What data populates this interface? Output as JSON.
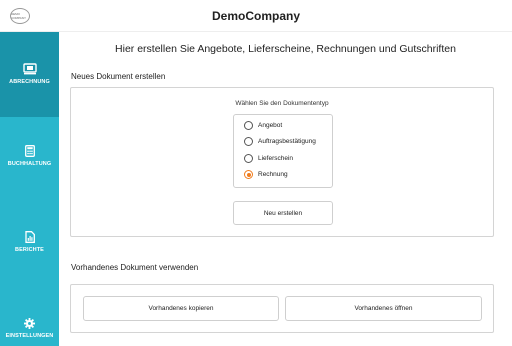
{
  "header": {
    "title": "DemoCompany",
    "logo_text": "DEMO COMPANY"
  },
  "sidebar": {
    "items": [
      {
        "label": "ABRECHNUNG",
        "icon": "billing-icon",
        "active": true
      },
      {
        "label": "BUCHHALTUNG",
        "icon": "calculator-icon",
        "active": false
      },
      {
        "label": "BERICHTE",
        "icon": "report-icon",
        "active": false
      },
      {
        "label": "EINSTELLUNGEN",
        "icon": "gear-icon",
        "active": false
      }
    ]
  },
  "main": {
    "headline": "Hier erstellen Sie Angebote, Lieferscheine, Rechnungen und Gutschriften",
    "new_doc": {
      "section_label": "Neues Dokument erstellen",
      "type_label": "Wählen Sie den Dokumententyp",
      "options": [
        "Angebot",
        "Auftragsbestätigung",
        "Lieferschein",
        "Rechnung"
      ],
      "selected": "Rechnung",
      "create_button": "Neu erstellen"
    },
    "existing_doc": {
      "section_label": "Vorhandenes Dokument verwenden",
      "copy_button": "Vorhandenes kopieren",
      "open_button": "Vorhandenes öffnen"
    }
  },
  "colors": {
    "sidebar": "#29b6cc",
    "sidebar_active": "#1a93a9",
    "accent": "#f07c1e"
  }
}
